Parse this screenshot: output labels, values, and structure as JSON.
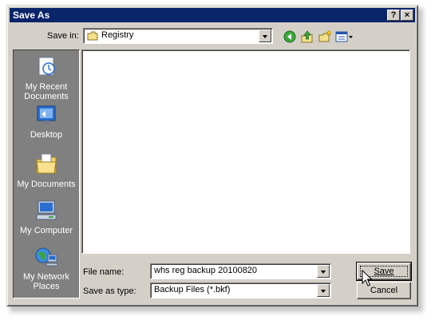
{
  "window": {
    "title": "Save As",
    "help_label": "?",
    "close_label": "×"
  },
  "toolbar": {
    "save_in_label": "Save in:",
    "save_in_value": "Registry",
    "icons": [
      "back-icon",
      "up-folder-icon",
      "new-folder-icon",
      "views-menu-icon"
    ]
  },
  "places": [
    {
      "label": "My Recent Documents",
      "icon": "recent-documents-icon"
    },
    {
      "label": "Desktop",
      "icon": "desktop-icon"
    },
    {
      "label": "My Documents",
      "icon": "my-documents-icon"
    },
    {
      "label": "My Computer",
      "icon": "my-computer-icon"
    },
    {
      "label": "My Network Places",
      "icon": "network-places-icon"
    }
  ],
  "file_list": {
    "items": []
  },
  "form": {
    "file_name_label": "File name:",
    "file_name_value": "whs reg backup 20100820",
    "save_as_type_label": "Save as type:",
    "save_as_type_value": "Backup Files (*.bkf)"
  },
  "buttons": {
    "save_label": "Save",
    "cancel_label": "Cancel"
  }
}
